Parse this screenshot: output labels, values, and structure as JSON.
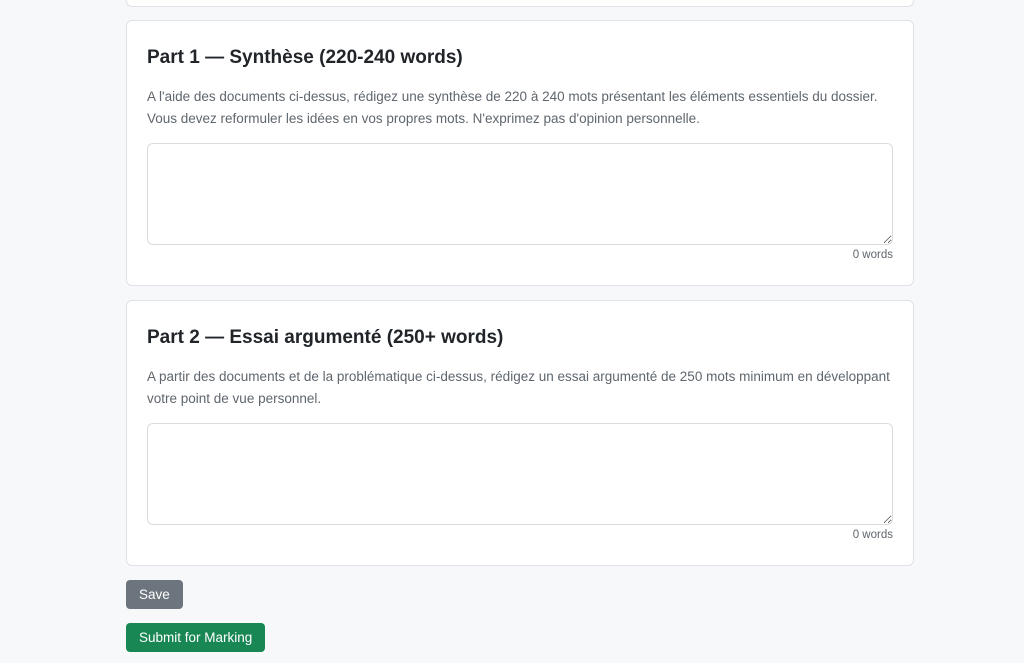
{
  "part1": {
    "title": "Part 1 — Synthèse (220-240 words)",
    "description": "A l'aide des documents ci-dessus, rédigez une synthèse de 220 à 240 mots présentant les éléments essentiels du dossier. Vous devez reformuler les idées en vos propres mots. N'exprimez pas d'opinion personnelle.",
    "answer_value": "",
    "word_count": "0 words"
  },
  "part2": {
    "title": "Part 2 — Essai argumenté (250+ words)",
    "description": "A partir des documents et de la problématique ci-dessus, rédigez un essai argumenté de 250 mots minimum en développant votre point de vue personnel.",
    "answer_value": "",
    "word_count": "0 words"
  },
  "actions": {
    "save_label": "Save",
    "submit_label": "Submit for Marking"
  },
  "colors": {
    "save_button": "#6c757d",
    "submit_button": "#198754",
    "page_background": "#f7f8fa"
  }
}
